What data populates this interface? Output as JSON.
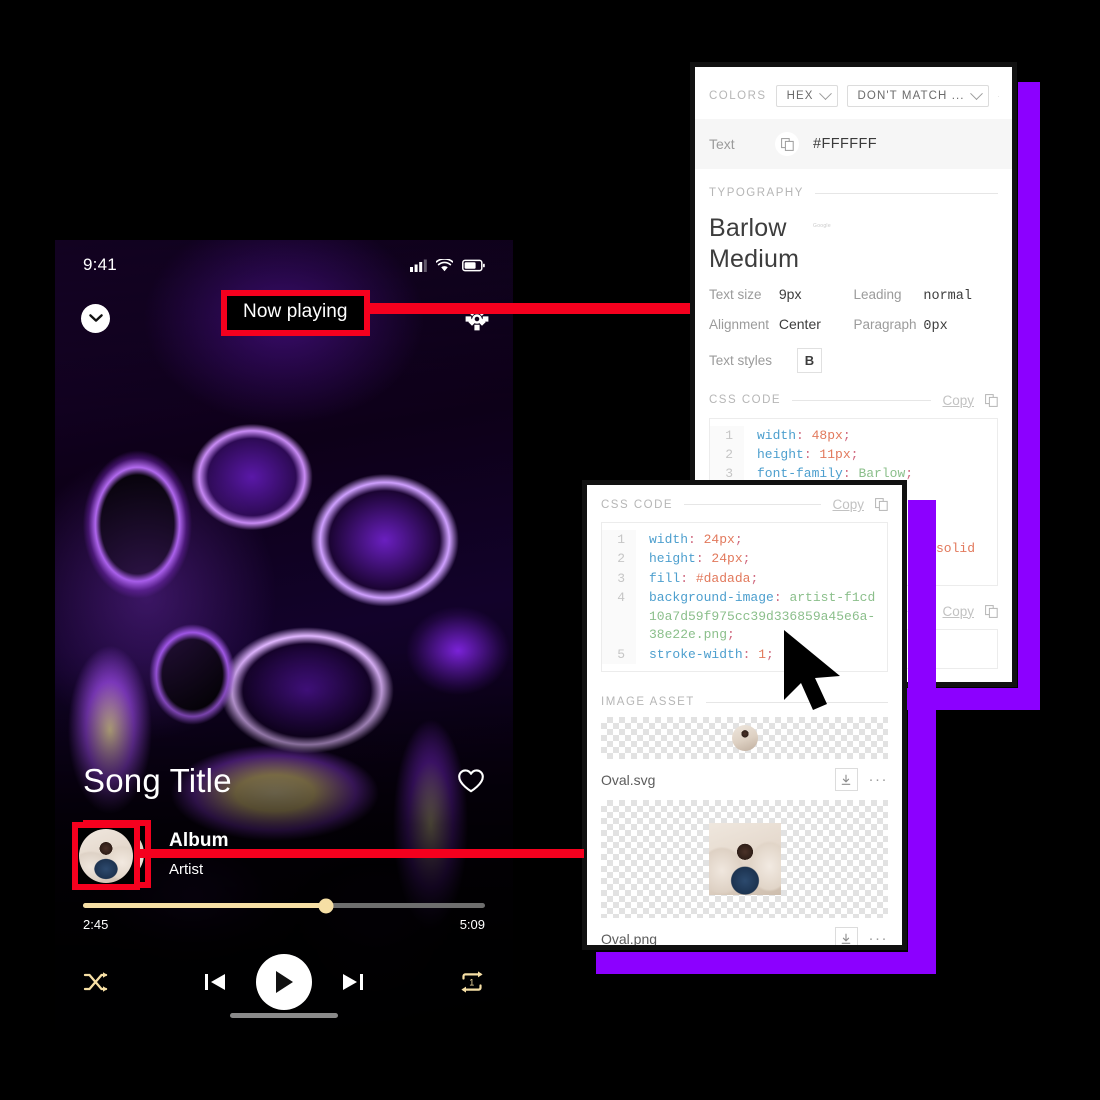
{
  "phone": {
    "status": {
      "time": "9:41",
      "icons": [
        "cellular-signal-icon",
        "wifi-icon",
        "battery-icon"
      ]
    },
    "topbar": {
      "collapse_icon": "chevron-down-icon",
      "title": "Now playing",
      "settings_icon": "gear-icon"
    },
    "song": {
      "title": "Song Title",
      "favorite_icon": "heart-icon",
      "album": "Album",
      "artist": "Artist",
      "avatar": "artist-avatar"
    },
    "progress": {
      "elapsed": "2:45",
      "total": "5:09",
      "percent": 60.5
    },
    "controls": {
      "shuffle": "shuffle-icon",
      "previous": "skip-previous-icon",
      "play": "play-icon",
      "next": "skip-next-icon",
      "repeat": "repeat-one-icon",
      "accent_color": "#f6dfa5"
    }
  },
  "inspector_back": {
    "colors": {
      "section_label": "COLORS",
      "format_select": "HEX",
      "match_select": "DON'T MATCH ...",
      "row_label": "Text",
      "copy_icon": "copy-icon",
      "value": "#FFFFFF"
    },
    "typography": {
      "section_label": "TYPOGRAPHY",
      "font_name": "Barlow",
      "font_weight": "Medium",
      "source_tag": "Google",
      "fields": [
        {
          "key": "Text size",
          "value": "9px"
        },
        {
          "key": "Leading",
          "value": "normal"
        },
        {
          "key": "Alignment",
          "value": "Center"
        },
        {
          "key": "Paragraph",
          "value": "0px"
        }
      ],
      "styles_label": "Text styles",
      "style_bold": "B"
    },
    "css": {
      "section_label": "CSS CODE",
      "copy_label": "Copy",
      "copy_icon": "copy-icon",
      "lines": [
        {
          "n": "1",
          "prop": "width",
          "val": "48px",
          "type": "num"
        },
        {
          "n": "2",
          "prop": "height",
          "val": "11px",
          "type": "num"
        },
        {
          "n": "3",
          "prop": "font-family",
          "val": "Barlow",
          "type": "str"
        }
      ],
      "partial_token": "solid"
    },
    "second_copy_label": "Copy"
  },
  "inspector_front": {
    "css": {
      "section_label": "CSS CODE",
      "copy_label": "Copy",
      "copy_icon": "copy-icon",
      "lines": [
        {
          "n": "1",
          "prop": "width",
          "val": "24px",
          "type": "num"
        },
        {
          "n": "2",
          "prop": "height",
          "val": "24px",
          "type": "num"
        },
        {
          "n": "3",
          "prop": "fill",
          "val": "#dadada",
          "type": "num"
        },
        {
          "n": "4",
          "prop": "background-image",
          "val": "artist-f1cd10a7d59f975cc39d336859a45e6a-38e22e.png",
          "type": "str"
        },
        {
          "n": "5",
          "prop": "stroke-width",
          "val": "1",
          "type": "num"
        }
      ]
    },
    "image_asset": {
      "section_label": "IMAGE ASSET",
      "items": [
        {
          "name": "Oval.svg",
          "download_icon": "download-icon",
          "more_icon": "more-options-icon"
        },
        {
          "name": "Oval.png",
          "download_icon": "download-icon",
          "more_icon": "more-options-icon"
        }
      ]
    }
  },
  "annotations": {
    "highlight_color": "#f5001e",
    "shadow_color": "#8c00ff",
    "cursor": "mouse-cursor"
  }
}
